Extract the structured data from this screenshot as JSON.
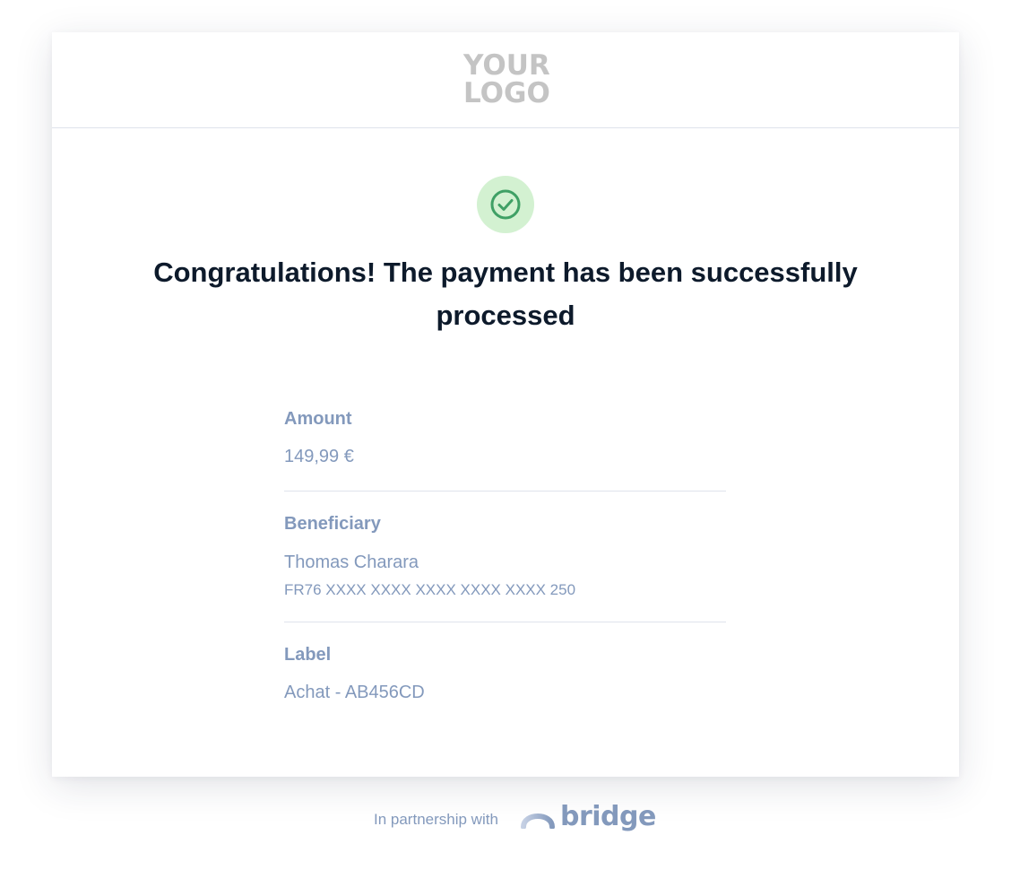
{
  "header": {
    "logo_line1": "YOUR",
    "logo_line2": "LOGO"
  },
  "status": {
    "icon": "check-circle-icon",
    "headline": "Congratulations! The payment has been successfully processed"
  },
  "details": {
    "amount": {
      "label": "Amount",
      "value": "149,99 €"
    },
    "beneficiary": {
      "label": "Beneficiary",
      "name": "Thomas Charara",
      "iban": "FR76 XXXX XXXX XXXX XXXX XXXX 250"
    },
    "label": {
      "label": "Label",
      "value": "Achat - AB456CD"
    }
  },
  "footer": {
    "partnership_text": "In partnership with",
    "brand": "bridge",
    "brand_icon": "bridge-arc-icon"
  },
  "colors": {
    "headline": "#0d1a2b",
    "muted_blue": "#8399bc",
    "success_bg": "#d3f1d1",
    "success_check": "#3fa065",
    "logo_gray": "#c4c4c4",
    "divider": "#dfe3ec"
  }
}
